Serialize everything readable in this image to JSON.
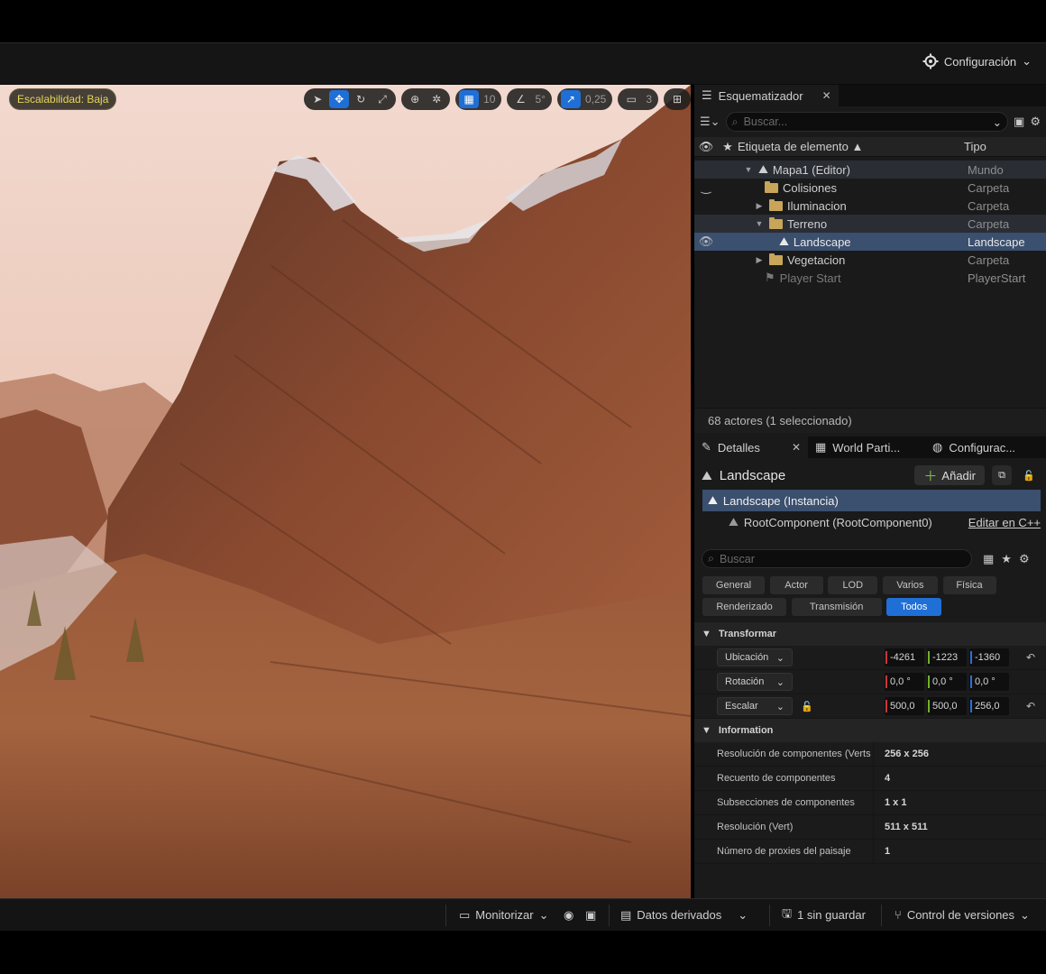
{
  "topbar": {
    "settings_label": "Configuración"
  },
  "viewport": {
    "scalability_badge": "Escalabilidad: Baja",
    "grid_value": "10",
    "angle_value": "5°",
    "scale_value": "0,25",
    "camera_value": "3"
  },
  "outliner": {
    "tab_label": "Esquematizador",
    "search_placeholder": "Buscar...",
    "col_label": "Etiqueta de elemento ▲",
    "col_type": "Tipo",
    "rows": [
      {
        "label": "Mapa1 (Editor)",
        "type": "Mundo"
      },
      {
        "label": "Colisiones",
        "type": "Carpeta"
      },
      {
        "label": "Iluminacion",
        "type": "Carpeta"
      },
      {
        "label": "Terreno",
        "type": "Carpeta"
      },
      {
        "label": "Landscape",
        "type": "Landscape"
      },
      {
        "label": "Vegetacion",
        "type": "Carpeta"
      },
      {
        "label": "Player Start",
        "type": "PlayerStart"
      }
    ],
    "status": "68 actores (1 seleccionado)"
  },
  "details_tabs": {
    "details": "Detalles",
    "world_partition": "World Parti...",
    "config": "Configurac..."
  },
  "details": {
    "title": "Landscape",
    "add_label": "Añadir",
    "instance_label": "Landscape (Instancia)",
    "root_component": "RootComponent (RootComponent0)",
    "edit_cpp": "Editar en C++",
    "search_placeholder": "Buscar",
    "filters": [
      "General",
      "Actor",
      "LOD",
      "Varios",
      "Física",
      "Renderizado",
      "Transmisión",
      "Todos"
    ],
    "transform": {
      "section": "Transformar",
      "location_label": "Ubicación",
      "location": [
        "-4261",
        "-1223",
        "-1360"
      ],
      "rotation_label": "Rotación",
      "rotation": [
        "0,0 °",
        "0,0 °",
        "0,0 °"
      ],
      "scale_label": "Escalar",
      "scale": [
        "500,0",
        "500,0",
        "256,0"
      ]
    },
    "information": {
      "section": "Information",
      "rows": [
        {
          "name": "Resolución de componentes (Verts",
          "value": "256 x 256"
        },
        {
          "name": "Recuento de componentes",
          "value": "4"
        },
        {
          "name": "Subsecciones de componentes",
          "value": "1 x 1"
        },
        {
          "name": "Resolución (Vert)",
          "value": "511 x 511"
        },
        {
          "name": "Número de proxies del paisaje",
          "value": "1"
        }
      ]
    }
  },
  "bottombar": {
    "monitor": "Monitorizar",
    "derived_data": "Datos derivados",
    "unsaved": "1 sin guardar",
    "version_control": "Control de versiones"
  }
}
